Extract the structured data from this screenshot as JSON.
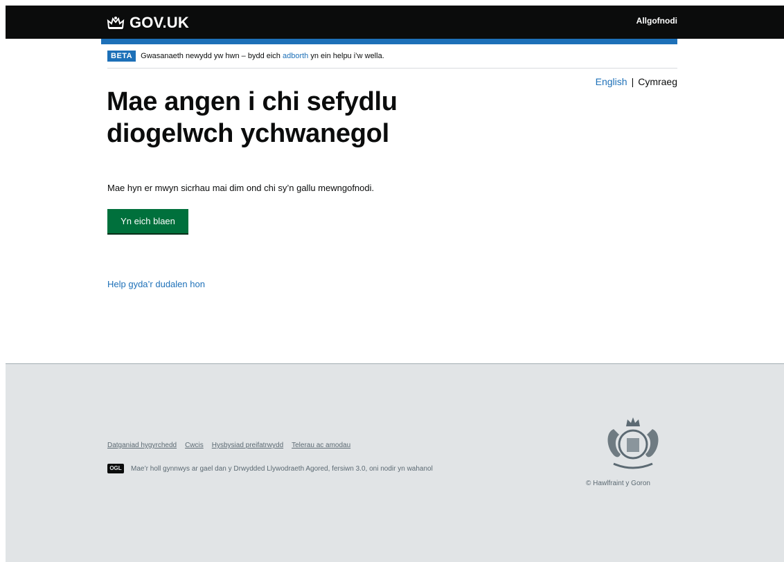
{
  "header": {
    "logo_text": "GOV.UK",
    "signout_label": "Allgofnodi"
  },
  "phase_banner": {
    "tag": "BETA",
    "text_before": "Gwasanaeth newydd yw hwn – bydd eich ",
    "link": "adborth",
    "text_after": " yn ein helpu i’w wella."
  },
  "language": {
    "english": "English",
    "separator": "|",
    "current": "Cymraeg"
  },
  "main": {
    "heading": "Mae angen i chi sefydlu diogelwch ychwanegol",
    "body": "Mae hyn er mwyn sicrhau mai dim ond chi sy’n gallu mewngofnodi.",
    "continue_label": "Yn eich blaen",
    "help_link": "Help gyda’r dudalen hon"
  },
  "footer": {
    "links": [
      "Datganiad hygyrchedd",
      "Cwcis",
      "Hysbysiad preifatrwydd",
      "Telerau ac amodau"
    ],
    "ogl_logo": "OGL",
    "licence_before": "Mae’r holl gynnwys ar gael dan y ",
    "licence_link": "Drwydded Llywodraeth Agored, fersiwn 3.0",
    "licence_after": ", oni nodir yn wahanol",
    "copyright": "© Hawlfraint y Goron"
  },
  "colors": {
    "brand_blue": "#1d70b8",
    "button_green": "#00703c",
    "header_black": "#0b0c0c",
    "footer_grey": "#e1e4e6"
  }
}
